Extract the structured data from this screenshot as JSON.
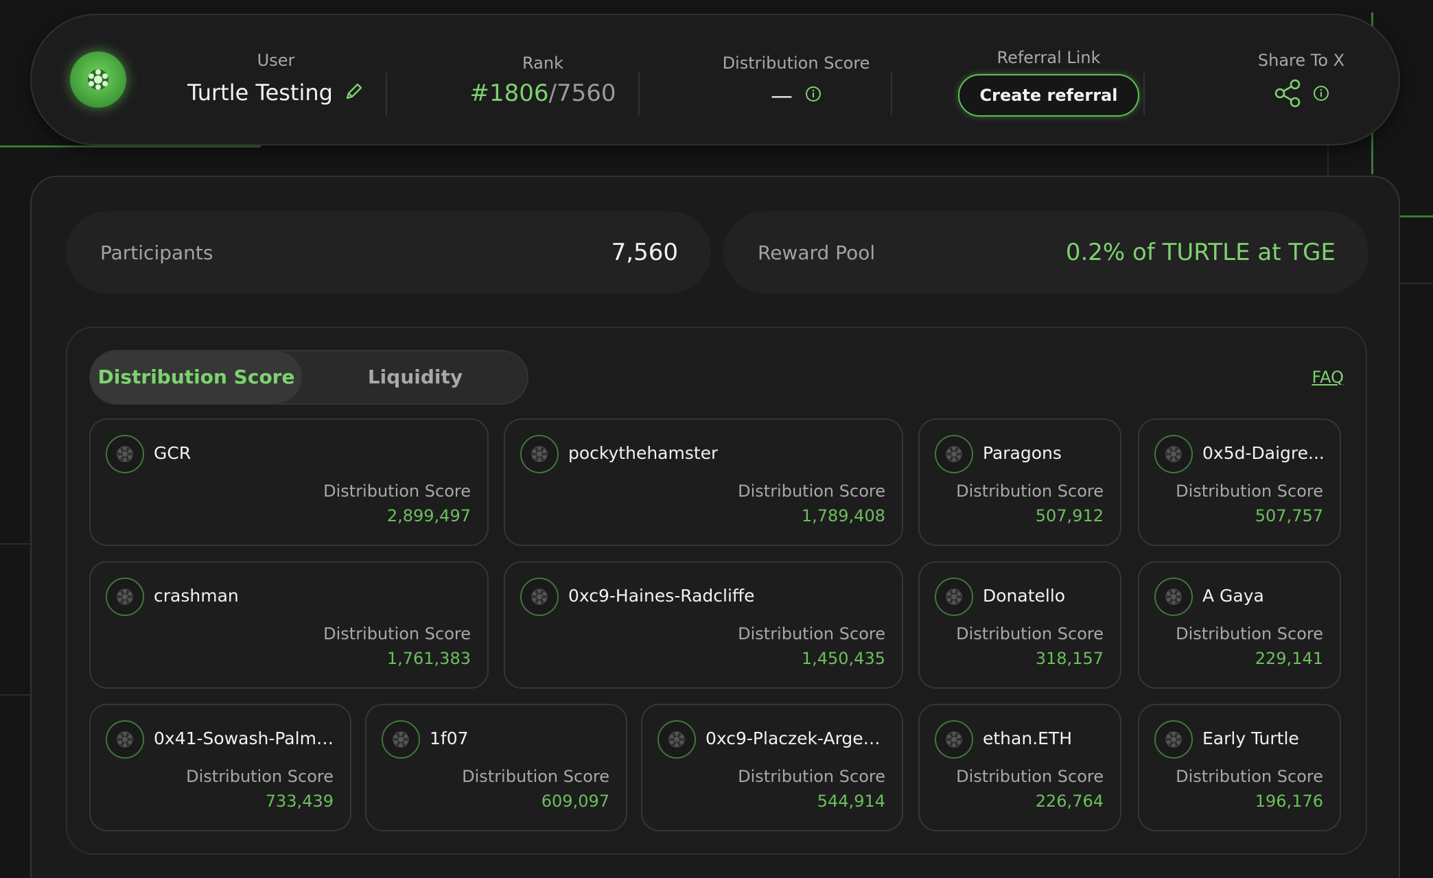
{
  "header": {
    "user_label": "User",
    "user_name": "Turtle Testing",
    "rank_label": "Rank",
    "rank_current": "#1806",
    "rank_separator": "/",
    "rank_total": "7560",
    "dist_label": "Distribution Score",
    "dist_value": "—",
    "referral_label": "Referral Link",
    "referral_button": "Create referral",
    "share_label": "Share To X"
  },
  "stats": {
    "participants_label": "Participants",
    "participants_value": "7,560",
    "reward_label": "Reward Pool",
    "reward_value": "0.2% of TURTLE at TGE"
  },
  "tabs": {
    "active": "Distribution Score",
    "inactive": "Liquidity"
  },
  "faq_label": "FAQ",
  "score_label": "Distribution Score",
  "cards": [
    {
      "name": "GCR",
      "score": "2,899,497"
    },
    {
      "name": "pockythehamster",
      "score": "1,789,408"
    },
    {
      "name": "Paragons",
      "score": "507,912"
    },
    {
      "name": "0x5d-Daigre...",
      "score": "507,757"
    },
    {
      "name": "crashman",
      "score": "1,761,383"
    },
    {
      "name": "0xc9-Haines-Radcliffe",
      "score": "1,450,435"
    },
    {
      "name": "Donatello",
      "score": "318,157"
    },
    {
      "name": "A Gaya",
      "score": "229,141"
    },
    {
      "name": "0x41-Sowash-Palmo...",
      "score": "733,439"
    },
    {
      "name": "1f07",
      "score": "609,097"
    },
    {
      "name": "0xc9-Placzek-Argen...",
      "score": "544,914"
    },
    {
      "name": "ethan.ETH",
      "score": "226,764"
    },
    {
      "name": "Early Turtle",
      "score": "196,176"
    }
  ],
  "colors": {
    "accent": "#7dd36f",
    "background": "#151515",
    "panel": "#1b1b1b"
  },
  "icons": [
    "turtle-logo-icon",
    "pencil-icon",
    "info-icon",
    "share-icon",
    "turtle-avatar-icon"
  ]
}
